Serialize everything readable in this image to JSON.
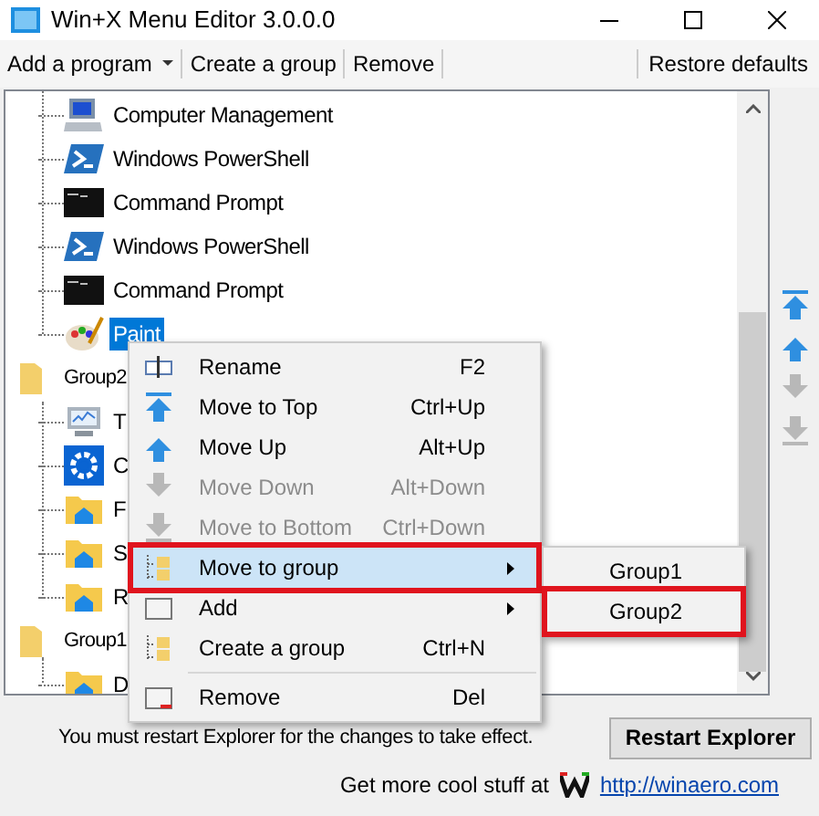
{
  "window": {
    "title": "Win+X Menu Editor 3.0.0.0"
  },
  "toolbar": [
    {
      "label": "Add a program",
      "dropdown": true
    },
    {
      "label": "Create a group",
      "dropdown": false
    },
    {
      "label": "Remove",
      "dropdown": false
    }
  ],
  "restore_defaults": "Restore defaults",
  "tree": {
    "items": [
      {
        "label": "Computer Management",
        "kind": "mgmt",
        "selected": false
      },
      {
        "label": "Windows PowerShell",
        "kind": "powershell",
        "selected": false
      },
      {
        "label": "Command Prompt",
        "kind": "cmd",
        "selected": false
      },
      {
        "label": "Windows PowerShell",
        "kind": "powershell",
        "selected": false
      },
      {
        "label": "Command Prompt",
        "kind": "cmd",
        "selected": false
      },
      {
        "label": "Paint",
        "kind": "paint",
        "selected": true
      }
    ],
    "groups": [
      {
        "label": "Group2",
        "children": [
          {
            "label": "T",
            "kind": "monitor",
            "selected": false
          },
          {
            "label": "C",
            "kind": "gear",
            "selected": false
          },
          {
            "label": "F",
            "kind": "folder",
            "selected": false
          },
          {
            "label": "S",
            "kind": "folder",
            "selected": false
          },
          {
            "label": "R",
            "kind": "folder",
            "selected": false
          }
        ]
      },
      {
        "label": "Group1",
        "children": [
          {
            "label": "D",
            "kind": "folder",
            "selected": false
          }
        ]
      }
    ]
  },
  "side_buttons": [
    {
      "kind": "top",
      "disabled": false
    },
    {
      "kind": "up",
      "disabled": false
    },
    {
      "kind": "down",
      "disabled": true
    },
    {
      "kind": "bottom",
      "disabled": true
    }
  ],
  "context_menu": [
    {
      "kind": "rename",
      "label": "Rename",
      "shortcut": "F2",
      "disabled": false,
      "selected": false,
      "submenu": false,
      "highlighted": false
    },
    {
      "kind": "top",
      "label": "Move to Top",
      "shortcut": "Ctrl+Up",
      "disabled": false,
      "selected": false,
      "submenu": false,
      "highlighted": false
    },
    {
      "kind": "up",
      "label": "Move Up",
      "shortcut": "Alt+Up",
      "disabled": false,
      "selected": false,
      "submenu": false,
      "highlighted": false
    },
    {
      "kind": "down",
      "label": "Move Down",
      "shortcut": "Alt+Down",
      "disabled": true,
      "selected": false,
      "submenu": false,
      "highlighted": false
    },
    {
      "kind": "bottom",
      "label": "Move to Bottom",
      "shortcut": "Ctrl+Down",
      "disabled": true,
      "selected": false,
      "submenu": false,
      "highlighted": false
    },
    {
      "kind": "group",
      "label": "Move to group",
      "disabled": false,
      "selected": true,
      "submenu": true,
      "highlighted": true
    },
    {
      "kind": "window",
      "label": "Add",
      "disabled": false,
      "selected": false,
      "submenu": true,
      "highlighted": false
    },
    {
      "kind": "group",
      "label": "Create a group",
      "shortcut": "Ctrl+N",
      "disabled": false,
      "selected": false,
      "submenu": false,
      "highlighted": false
    },
    {
      "kind": "separator"
    },
    {
      "kind": "remove",
      "label": "Remove",
      "shortcut": "Del",
      "disabled": false,
      "selected": false,
      "submenu": false,
      "highlighted": false
    }
  ],
  "submenu": [
    {
      "label": "Group1",
      "highlighted": false
    },
    {
      "label": "Group2",
      "highlighted": true
    }
  ],
  "restart_message": "You must restart Explorer for the changes to take effect.",
  "restart_button": "Restart Explorer",
  "footer": {
    "text": "Get more cool stuff at",
    "link": "http://winaero.com"
  }
}
